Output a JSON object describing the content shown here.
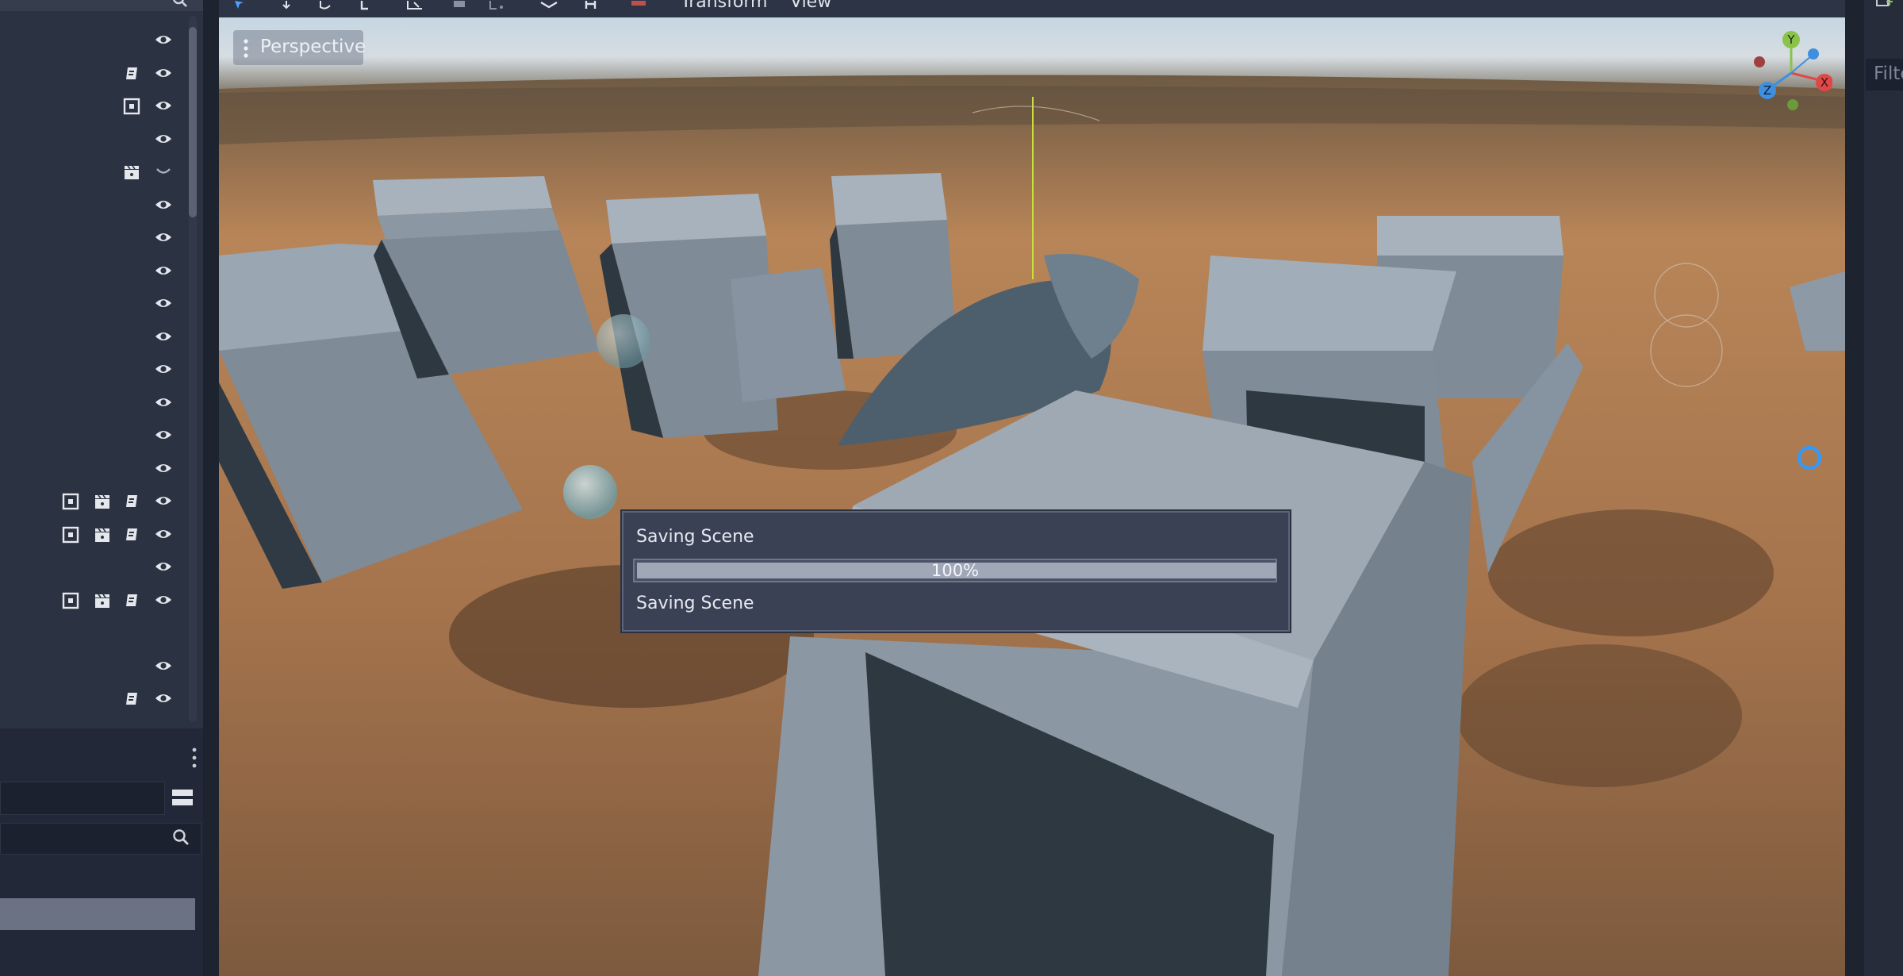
{
  "toolbar": {
    "menu_transform": "Transform",
    "menu_view": "View"
  },
  "viewport": {
    "perspective_label": "Perspective",
    "gizmo_axes": {
      "y": "Y",
      "x": "X",
      "z": "Z"
    }
  },
  "scene_tree": {
    "rows": [
      {
        "icons": [],
        "visible": true
      },
      {
        "icons": [
          "script-icon"
        ],
        "visible": true
      },
      {
        "icons": [
          "node-icon"
        ],
        "visible": true
      },
      {
        "icons": [],
        "visible": true
      },
      {
        "icons": [
          "clapper-icon"
        ],
        "visible": "collapse"
      },
      {
        "icons": [],
        "visible": true
      },
      {
        "icons": [],
        "visible": true
      },
      {
        "icons": [],
        "visible": true
      },
      {
        "icons": [],
        "visible": true
      },
      {
        "icons": [],
        "visible": true
      },
      {
        "icons": [],
        "visible": true
      },
      {
        "icons": [],
        "visible": true
      },
      {
        "icons": [],
        "visible": true
      },
      {
        "icons": [],
        "visible": true
      },
      {
        "icons": [
          "node-icon",
          "clapper-icon",
          "script-icon"
        ],
        "visible": true
      },
      {
        "icons": [
          "node-icon",
          "clapper-icon",
          "script-icon"
        ],
        "visible": true
      },
      {
        "icons": [],
        "visible": true
      },
      {
        "icons": [
          "node-icon",
          "clapper-icon",
          "script-icon"
        ],
        "visible": true
      },
      {
        "icons": [],
        "visible": null
      },
      {
        "icons": [],
        "visible": true
      },
      {
        "icons": [
          "script-icon"
        ],
        "visible": true
      }
    ]
  },
  "right_panel": {
    "filter_placeholder": "Filte"
  },
  "dialog": {
    "title": "Saving Scene",
    "progress": 100,
    "progress_text": "100%",
    "status": "Saving Scene"
  },
  "colors": {
    "accent": "#4aa3ff",
    "panel": "#2b3242",
    "dialog_bg": "#3a4155"
  }
}
